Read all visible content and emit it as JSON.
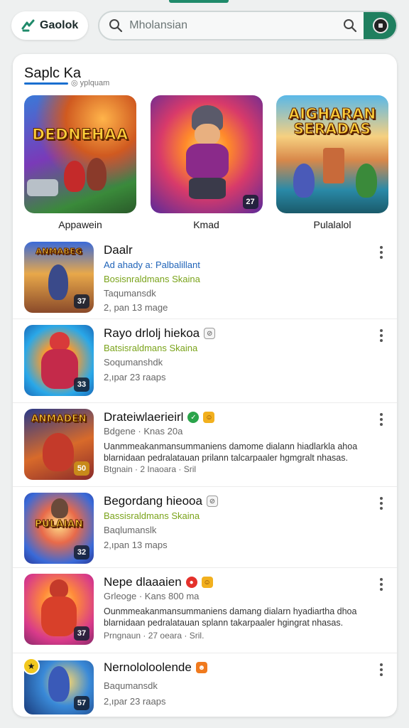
{
  "brand": {
    "name": "Gaolok"
  },
  "search": {
    "placeholder": "Mholansian"
  },
  "section": {
    "title": "Saplc Ka",
    "subtitle": "◎ yplquam"
  },
  "featured": [
    {
      "label": "Appawein",
      "art_title": "DEDNEHAA",
      "badge": ""
    },
    {
      "label": "Kmad",
      "art_title": "",
      "badge": "27"
    },
    {
      "label": "Pulalalol",
      "art_title": "AIGHARAN\nSERADAS",
      "badge": ""
    }
  ],
  "apps": [
    {
      "title": "Daalr",
      "art_title": "ANMABEG",
      "badge": "37",
      "chips": [],
      "lines": [
        {
          "text": "Ad ahady a: Palbalillant",
          "style": "blue"
        },
        {
          "text": "Bosisnraldmans Skaina",
          "style": "green"
        },
        {
          "text": "Taqumansdk",
          "style": "grey"
        },
        {
          "text": "2, pan 13 mage",
          "style": "grey"
        }
      ]
    },
    {
      "title": "Rayo drlolj hiekoa",
      "art_title": "",
      "badge": "33",
      "chips": [
        "grey"
      ],
      "lines": [
        {
          "text": "Batsisraldmans Skaina",
          "style": "green"
        },
        {
          "text": "Soqumanshdk",
          "style": "grey"
        },
        {
          "text": "2,ıpar 23 raaps",
          "style": "grey"
        }
      ]
    },
    {
      "title": "Drateiwlaerieirl",
      "art_title": "ANMADEN",
      "badge": "50",
      "chips": [
        "ok",
        "yel"
      ],
      "lines": [
        {
          "text": "Bdgene · Knas 20a",
          "style": "grey"
        },
        {
          "text": "Uanmmeakanmansummaniens damome dialann hiadlarkla ahoa",
          "style": "dark"
        },
        {
          "text": "blarnidaan pedralatauan prilann talcarpaaler hgmgralt nhasas.",
          "style": "dark"
        },
        {
          "text": "Btgnain · 2 Inaoara · Sril",
          "style": "grey"
        }
      ]
    },
    {
      "title": "Begordang hieooa",
      "art_title": "PULAIAN",
      "badge": "32",
      "chips": [
        "grey"
      ],
      "lines": [
        {
          "text": "Bassisraldmans Skaina",
          "style": "green"
        },
        {
          "text": "Baqlumanslk",
          "style": "grey"
        },
        {
          "text": "2,ıpan 13 maps",
          "style": "grey"
        }
      ]
    },
    {
      "title": "Nepe dlaaaien",
      "art_title": "",
      "badge": "37",
      "chips": [
        "red",
        "yel"
      ],
      "lines": [
        {
          "text": "Grleoge · Kans 800 ma",
          "style": "grey"
        },
        {
          "text": "Ounmmeakanmansummaniens damang dialarn hyadiartha dhoa",
          "style": "dark"
        },
        {
          "text": "blarnidaan pedralatauan splann takarpaaler hgingrat nhasas.",
          "style": "dark"
        },
        {
          "text": "Prngnaun · 27 oeara · Sril.",
          "style": "grey"
        }
      ]
    },
    {
      "title": "Nernololoolende",
      "art_title": "",
      "badge": "57",
      "chips": [
        "org"
      ],
      "lines": [
        {
          "text": "Baqumansdk",
          "style": "grey"
        },
        {
          "text": "2,ıpar 23 raaps",
          "style": "grey"
        }
      ]
    }
  ],
  "colors": {
    "accent": "#1f7f5f",
    "link_blue": "#1f63b8",
    "green_text": "#7aa31a"
  }
}
